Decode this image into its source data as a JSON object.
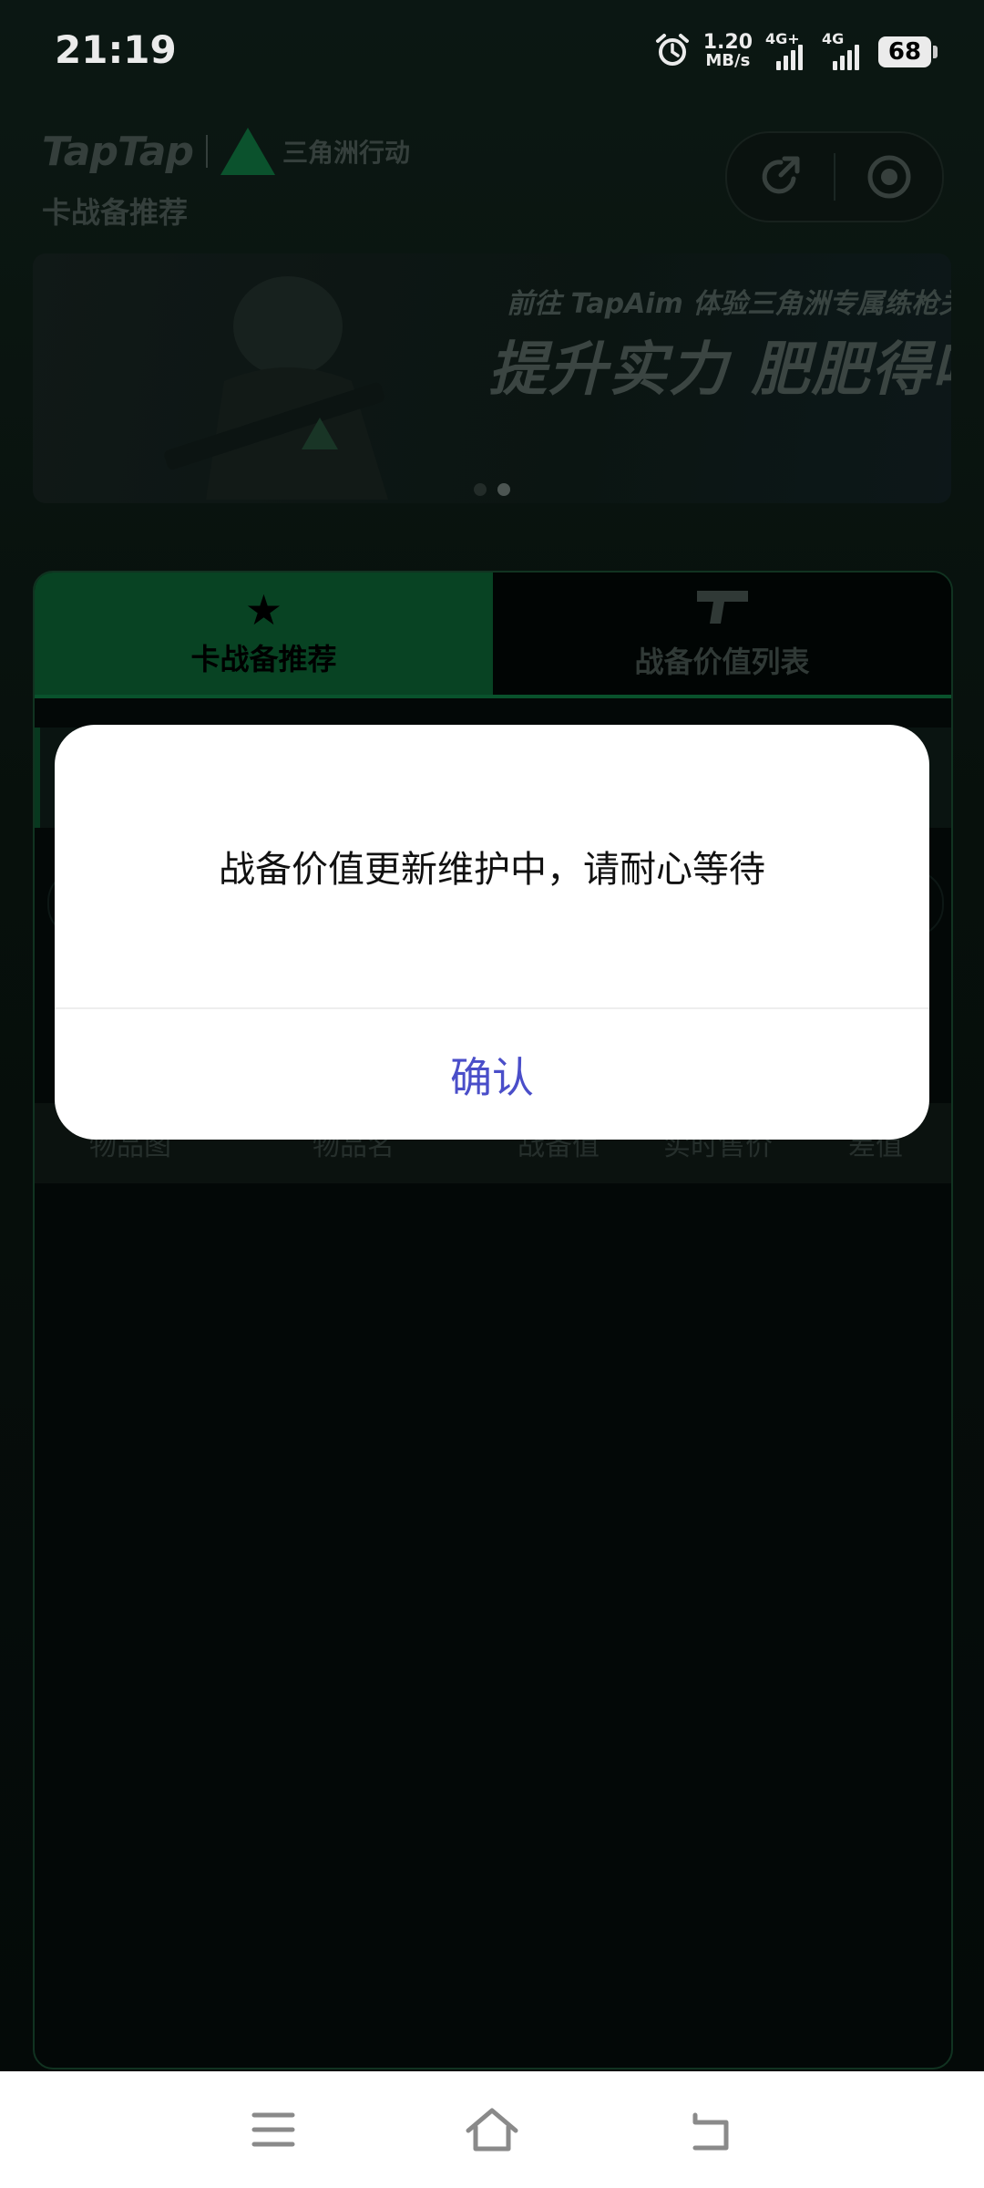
{
  "status_bar": {
    "time": "21:19",
    "net_speed_value": "1.20",
    "net_speed_unit": "MB/s",
    "sim1_type": "4G+",
    "sim2_type": "4G",
    "battery": "68"
  },
  "header": {
    "brand": "TapTap",
    "game_name": "三角洲行动",
    "subtitle": "卡战备推荐"
  },
  "banner": {
    "line1": "前往 TapAim 体验三角洲专属练枪关卡",
    "line2": "提升实力 肥肥得吃",
    "active_slide": 2,
    "slide_count": 2
  },
  "tabs": [
    {
      "label": "卡战备推荐",
      "icon": "star-icon",
      "active": true
    },
    {
      "label": "战备价值列表",
      "icon": "pistol-icon",
      "active": false
    }
  ],
  "table": {
    "columns": [
      "物品图",
      "物品名",
      "战备值",
      "实时售价",
      "差值"
    ]
  },
  "dialog": {
    "message": "战备价值更新维护中，请耐心等待",
    "confirm_label": "确认"
  },
  "colors": {
    "accent_green": "#0a5a30",
    "dialog_button": "#4a4ec9"
  }
}
